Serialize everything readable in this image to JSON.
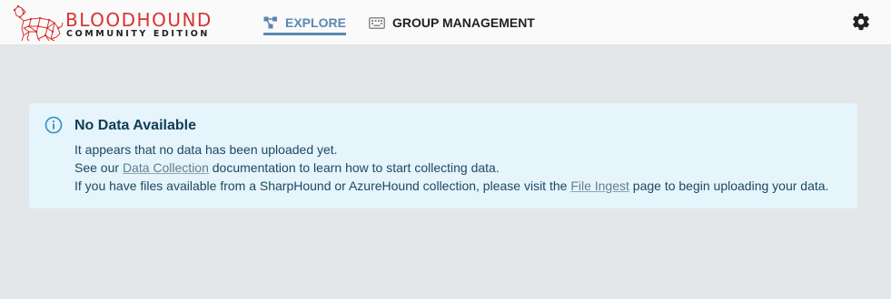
{
  "brand": {
    "name_part1": "BLOOD",
    "name_part2": "HOUND",
    "edition": "COMMUNITY EDITION",
    "color": "#d9322f"
  },
  "nav": {
    "explore": {
      "label": "EXPLORE",
      "icon": "graph-nodes-icon",
      "active": true,
      "color": "#5a87b1"
    },
    "group_management": {
      "label": "GROUP MANAGEMENT",
      "icon": "keyboard-icon",
      "active": false
    }
  },
  "settings": {
    "icon": "gear-icon"
  },
  "alert": {
    "icon": "info-circle-icon",
    "title": "No Data Available",
    "line1": "It appears that no data has been uploaded yet.",
    "line2_prefix": "See our ",
    "line2_link": "Data Collection",
    "line2_suffix": " documentation to learn how to start collecting data.",
    "line3_prefix": "If you have files available from a SharpHound or AzureHound collection, please visit the ",
    "line3_link": "File Ingest",
    "line3_suffix": " page to begin uploading your data.",
    "background": "#e6f4fb"
  }
}
